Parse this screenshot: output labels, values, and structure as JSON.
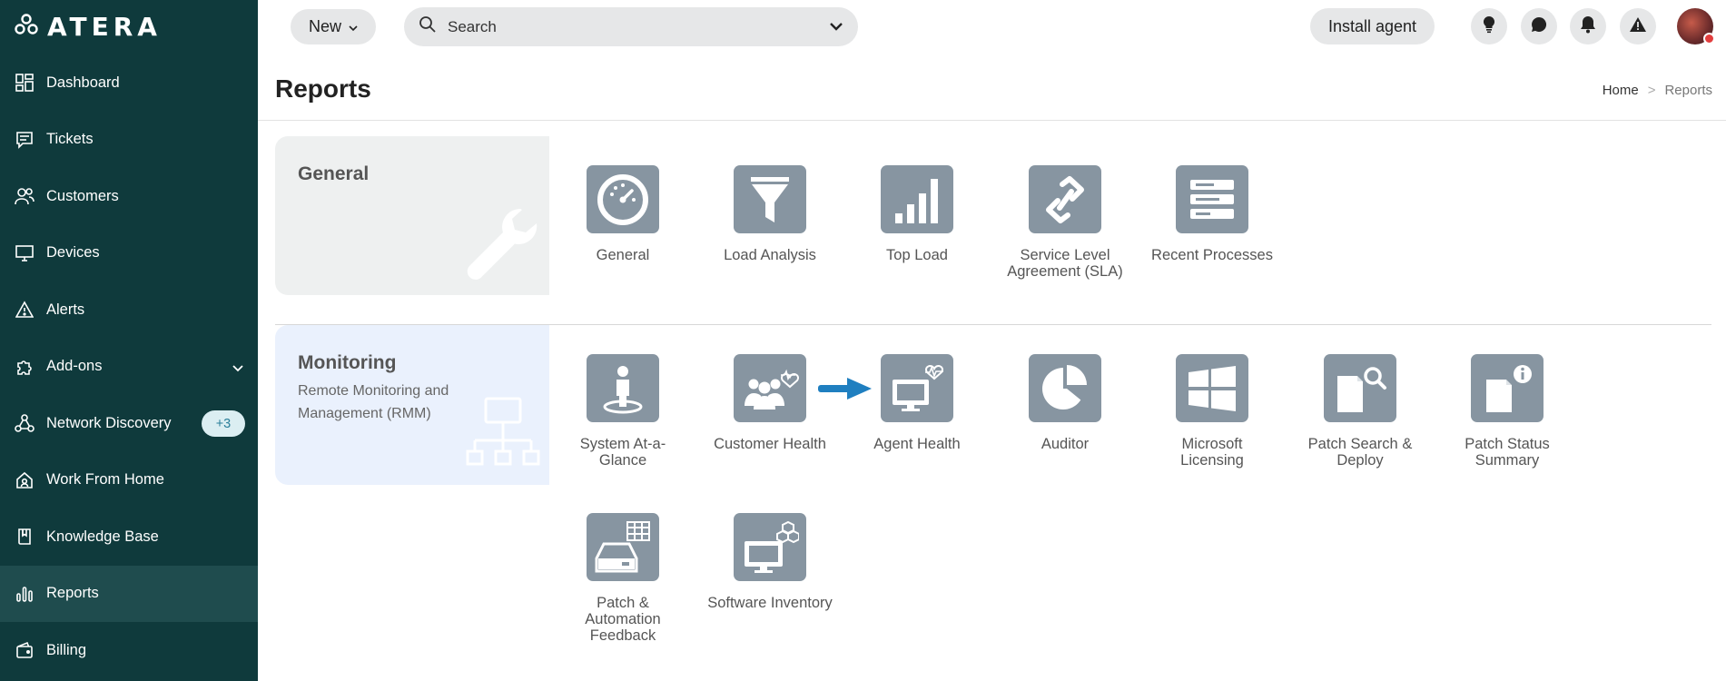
{
  "brand": {
    "logo_text": "ATERA"
  },
  "sidebar": {
    "items": [
      {
        "label": "Dashboard",
        "icon": "dashboard-icon"
      },
      {
        "label": "Tickets",
        "icon": "ticket-icon"
      },
      {
        "label": "Customers",
        "icon": "customers-icon"
      },
      {
        "label": "Devices",
        "icon": "monitor-icon"
      },
      {
        "label": "Alerts",
        "icon": "alert-triangle-icon"
      },
      {
        "label": "Add-ons",
        "icon": "puzzle-icon"
      },
      {
        "label": "Network Discovery",
        "icon": "network-icon",
        "badge": "+3"
      },
      {
        "label": "Work From Home",
        "icon": "home-icon"
      },
      {
        "label": "Knowledge Base",
        "icon": "book-icon"
      },
      {
        "label": "Reports",
        "icon": "bar-chart-icon",
        "active": true
      },
      {
        "label": "Billing",
        "icon": "wallet-icon"
      }
    ]
  },
  "topbar": {
    "new_label": "New",
    "search_placeholder": "Search",
    "install_label": "Install agent"
  },
  "page": {
    "title": "Reports",
    "breadcrumb": {
      "home": "Home",
      "separator": ">",
      "current": "Reports"
    }
  },
  "sections": {
    "general": {
      "title": "General",
      "tiles": [
        {
          "label": "General",
          "icon": "gauge-icon"
        },
        {
          "label": "Load Analysis",
          "icon": "funnel-icon"
        },
        {
          "label": "Top Load",
          "icon": "signal-bars-icon"
        },
        {
          "label": "Service Level Agreement (SLA)",
          "icon": "link-icon"
        },
        {
          "label": "Recent Processes",
          "icon": "server-list-icon"
        }
      ]
    },
    "monitoring": {
      "title": "Monitoring",
      "subtitle": "Remote Monitoring and Management (RMM)",
      "tiles": [
        {
          "label": "System At-a-Glance",
          "icon": "person-pin-icon"
        },
        {
          "label": "Customer Health",
          "icon": "group-heart-icon"
        },
        {
          "label": "Agent Health",
          "icon": "monitor-heart-icon"
        },
        {
          "label": "Auditor",
          "icon": "pie-chart-icon"
        },
        {
          "label": "Microsoft Licensing",
          "icon": "windows-icon"
        },
        {
          "label": "Patch Search & Deploy",
          "icon": "file-search-icon"
        },
        {
          "label": "Patch Status Summary",
          "icon": "file-info-icon"
        },
        {
          "label": "Patch & Automation Feedback",
          "icon": "drive-grid-icon"
        },
        {
          "label": "Software Inventory",
          "icon": "monitor-cubes-icon"
        }
      ]
    }
  },
  "colors": {
    "sidebar_bg": "#0f3a3c",
    "sidebar_active": "#1f4c4e",
    "tile_bg": "#8795a1",
    "arrow": "#1f7fc0",
    "monitoring_bg": "#eaf1fd"
  }
}
